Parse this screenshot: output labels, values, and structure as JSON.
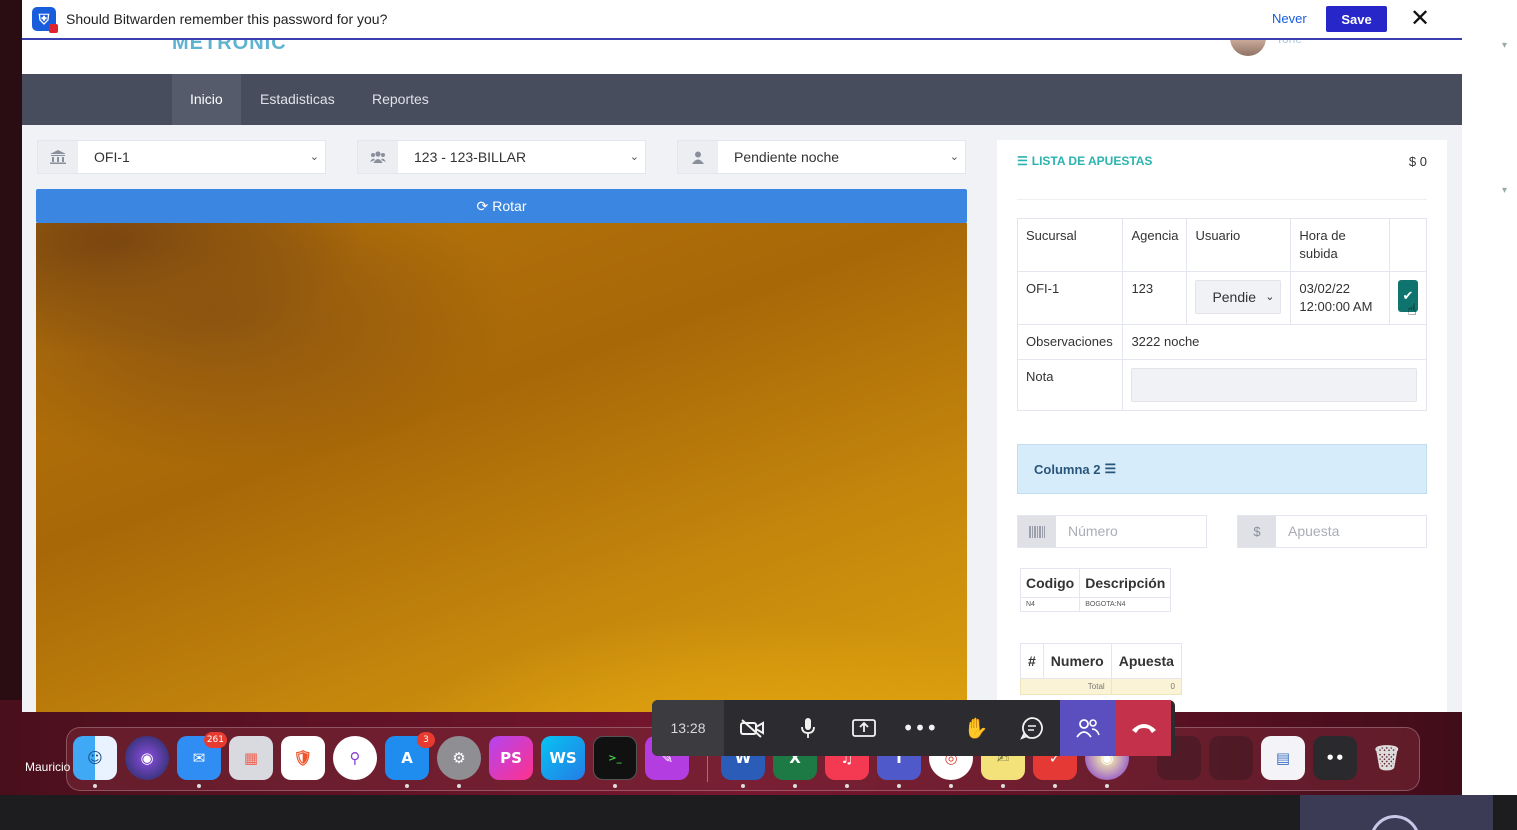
{
  "bitwarden": {
    "message": "Should Bitwarden remember this password for you?",
    "never": "Never",
    "save": "Save",
    "close": "✕",
    "icon": "bitwarden-shield-icon"
  },
  "header": {
    "logo": "METRONIC",
    "user": "Toñe"
  },
  "nav": {
    "items": [
      {
        "label": "Inicio",
        "active": true
      },
      {
        "label": "Estadisticas",
        "active": false
      },
      {
        "label": "Reportes",
        "active": false
      }
    ]
  },
  "filters": {
    "sucursal": "OFI-1",
    "agencia": "123 - 123-BILLAR",
    "usuario": "Pendiente noche"
  },
  "rotar_label": "Rotar",
  "panel": {
    "title": "LISTA DE APUESTAS",
    "total": "$ 0",
    "table": {
      "headers": [
        "Sucursal",
        "Agencia",
        "Usuario",
        "Hora de subida"
      ],
      "row": {
        "sucursal": "OFI-1",
        "agencia": "123",
        "usuario_select": "Pendie",
        "fecha": "03/02/22",
        "hora": "12:00:00 AM"
      },
      "obs_label": "Observaciones",
      "obs_value": "3222 noche",
      "nota_label": "Nota"
    },
    "columna": "Columna 2",
    "numero_placeholder": "Número",
    "apuesta_placeholder": "Apuesta",
    "codes": {
      "headers": [
        "Codigo",
        "Descripción"
      ],
      "rows": [
        [
          "N4",
          "BOGOTA:N4"
        ]
      ]
    },
    "bets": {
      "headers": [
        "#",
        "Numero",
        "Apuesta"
      ],
      "total_label": "Total",
      "total_value": "0"
    }
  },
  "call": {
    "time": "13:28"
  },
  "dock": {
    "user_label": "Mauricio",
    "mail_badge": "261",
    "appstore_badge": "3",
    "phpstorm": "PS",
    "webstorm": "WS"
  },
  "colors": {
    "nav_bg": "#474d5c",
    "accent_blue": "#3b86e0",
    "panel_title": "#2bb3b0",
    "check_btn": "#10746e",
    "hangup": "#c4314b"
  }
}
